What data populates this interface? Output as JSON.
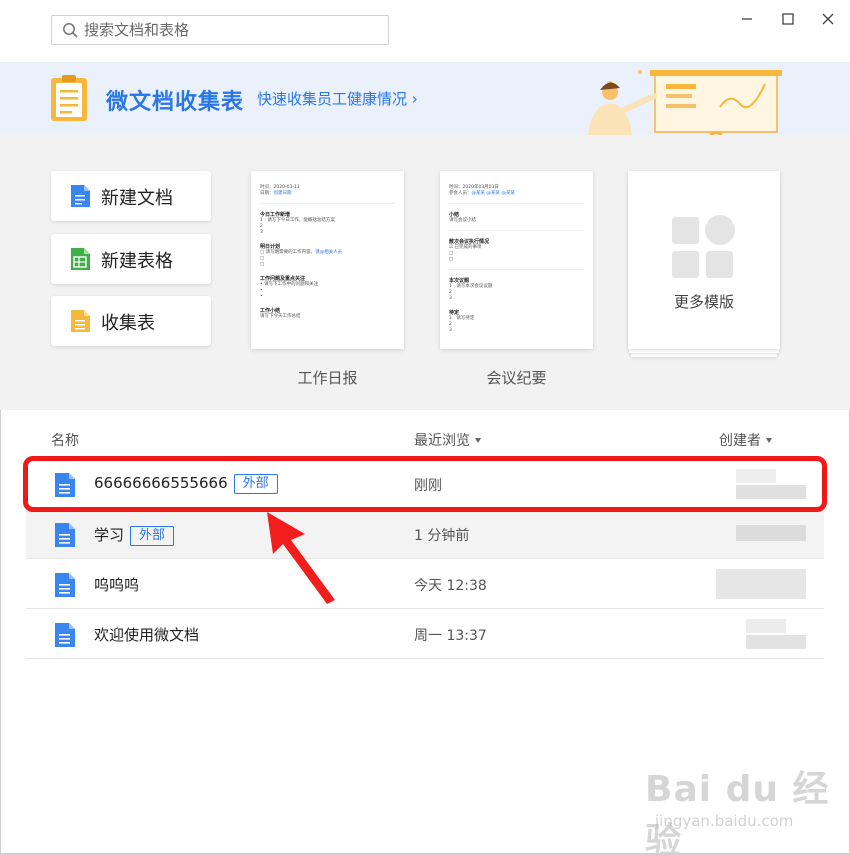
{
  "search": {
    "placeholder": "搜索文档和表格"
  },
  "banner": {
    "title": "微文档收集表",
    "link": "快速收集员工健康情况 ›"
  },
  "new_buttons": [
    {
      "label": "新建文档",
      "icon": "doc-icon",
      "color": "#3a86f0"
    },
    {
      "label": "新建表格",
      "icon": "sheet-icon",
      "color": "#3fae4a"
    },
    {
      "label": "收集表",
      "icon": "form-icon",
      "color": "#f4b83a"
    }
  ],
  "templates": [
    {
      "caption": "工作日报",
      "mini": {
        "meta1": "时间：2020-03-13",
        "meta2": "日期：",
        "meta2b": "创建日期",
        "h1": "今日工作新增",
        "l1": "1　请写下今日工作，能概括总结方案",
        "h2": "明日计划",
        "l2": "□ 请写明需要的工作内容，",
        "l2b": "请@相关人员",
        "h3": "工作问题及重点关注",
        "l3": "• 请写下工作中的问题和关注",
        "h4": "工作小结",
        "l4": "请写下今天工作总结"
      }
    },
    {
      "caption": "会议纪要",
      "mini": {
        "meta1": "时间：2020年03月03日",
        "meta2": "参会人员：",
        "meta2b": "@某某 @某某 @某某",
        "h1": "小结",
        "l1": "请写会议小结",
        "h2": "散次会议执行情况",
        "l2": "☑ 已完成的事项",
        "l2b": "",
        "h3": "本次议题",
        "l3": "1　请写本次会议议题",
        "h4": "待定",
        "l4": "1　请写待定"
      }
    }
  ],
  "more_templates": {
    "label": "更多模版"
  },
  "list": {
    "columns": {
      "name": "名称",
      "recent": "最近浏览",
      "creator": "创建者"
    },
    "rows": [
      {
        "name": "66666666555666",
        "tag": "外部",
        "time": "刚刚"
      },
      {
        "name": "学习",
        "tag": "外部",
        "time": "1 分钟前"
      },
      {
        "name": "呜呜呜",
        "tag": "",
        "time": "今天 12:38"
      },
      {
        "name": "欢迎使用微文档",
        "tag": "",
        "time": "周一 13:37"
      }
    ]
  },
  "watermark": {
    "logo": "Bai du 经验",
    "sub": "jingyan.baidu.com"
  },
  "colors": {
    "accent": "#2b77e6",
    "highlight": "#f11818",
    "banner_bg": "#eaf1fb"
  }
}
